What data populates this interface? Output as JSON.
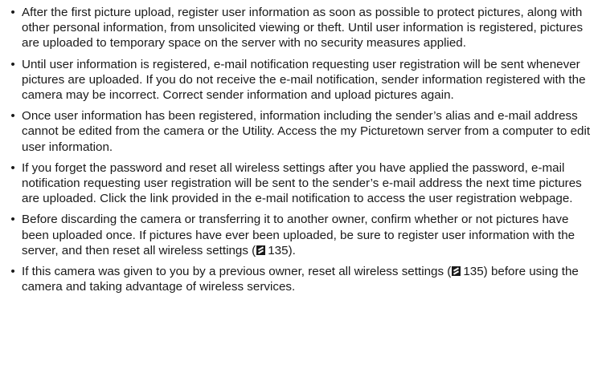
{
  "bullets": [
    {
      "text": "After the first picture upload, register user information as soon as possible to protect pictures, along with other personal information, from unsolicited viewing or theft. Until user information is registered, pictures are uploaded to temporary space on the server with no security measures applied."
    },
    {
      "text": "Until user information is registered, e-mail notification requesting user registration will be sent whenever pictures are uploaded. If you do not receive the e-mail notification, sender information registered with the camera may be incorrect. Correct sender information and upload pictures again."
    },
    {
      "text": "Once user information has been registered, information including the sender’s alias and e-mail address cannot be edited from the camera or the Utility. Access the my Picturetown server from a computer to edit user information."
    },
    {
      "text": "If you forget the password and reset all wireless settings after you have applied the password, e-mail notification requesting user registration will be sent to the sender’s e-mail address the next time pictures are uploaded. Click the link provided in the e-mail notification to access the user registration webpage."
    },
    {
      "text_before": "Before discarding the camera or transferring it to another owner, confirm whether or not pictures have been uploaded once. If pictures have ever been uploaded, be sure to register user information with the server, and then reset all wireless settings (",
      "ref_icon": "page-reference-icon",
      "page_ref": "135",
      "text_after": ")."
    },
    {
      "text_before": "If this camera was given to you by a previous owner, reset all wireless settings (",
      "ref_icon": "page-reference-icon",
      "page_ref": "135",
      "text_after": ") before using the camera and taking advantage of wireless services."
    }
  ]
}
